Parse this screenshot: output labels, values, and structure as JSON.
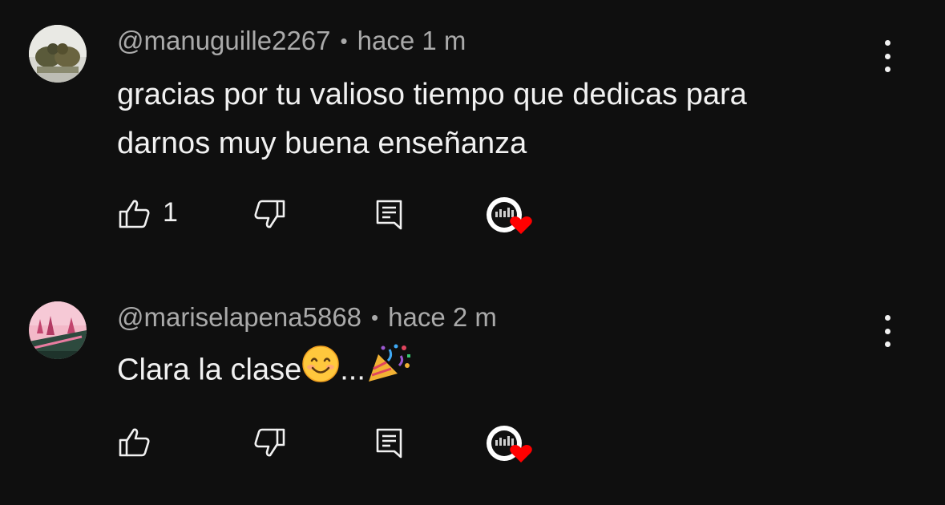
{
  "comments": [
    {
      "author": "@manuguille2267",
      "time": "hace 1 m",
      "text_lines": [
        "gracias por tu valioso tiempo que dedicas para",
        "darnos muy buena enseñanza"
      ],
      "like_count": "1"
    },
    {
      "author": "@mariselapena5868",
      "time": "hace 2 m",
      "text": "Clara la clase",
      "ellipsis": "...",
      "like_count": ""
    }
  ],
  "separator": "•",
  "colors": {
    "background": "#0f0f0f",
    "text": "#f1f1f1",
    "meta": "#aaaaaa",
    "heart": "#ff0000"
  },
  "icons": [
    "like-icon",
    "dislike-icon",
    "reply-icon",
    "creator-heart-icon",
    "more-options-icon",
    "smile-emoji",
    "party-popper-emoji"
  ]
}
